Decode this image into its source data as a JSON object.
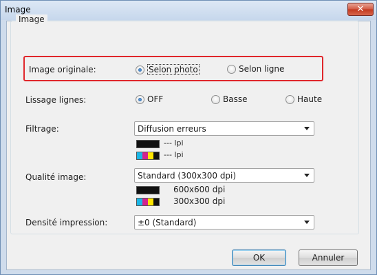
{
  "window": {
    "title": "Image",
    "close_symbol": "✕"
  },
  "group": {
    "title": "Image"
  },
  "image_originale": {
    "label": "Image originale:",
    "options": [
      {
        "label": "Selon photo",
        "selected": true
      },
      {
        "label": "Selon ligne",
        "selected": false
      }
    ]
  },
  "lissage": {
    "label": "Lissage lignes:",
    "options": [
      {
        "label": "OFF",
        "selected": true
      },
      {
        "label": "Basse",
        "selected": false
      },
      {
        "label": "Haute",
        "selected": false
      }
    ]
  },
  "filtrage": {
    "label": "Filtrage:",
    "value": "Diffusion erreurs",
    "black_info": "--- lpi",
    "color_info": "--- lpi"
  },
  "qualite": {
    "label": "Qualité image:",
    "value": "Standard (300x300 dpi)",
    "black_info": "600x600 dpi",
    "color_info": "300x300 dpi"
  },
  "densite": {
    "label": "Densité impression:",
    "value": "±0 (Standard)"
  },
  "buttons": {
    "ok": "OK",
    "cancel": "Annuler"
  },
  "colors": {
    "highlight": "#e0262b",
    "dialog_bg": "#f0f0f0"
  }
}
